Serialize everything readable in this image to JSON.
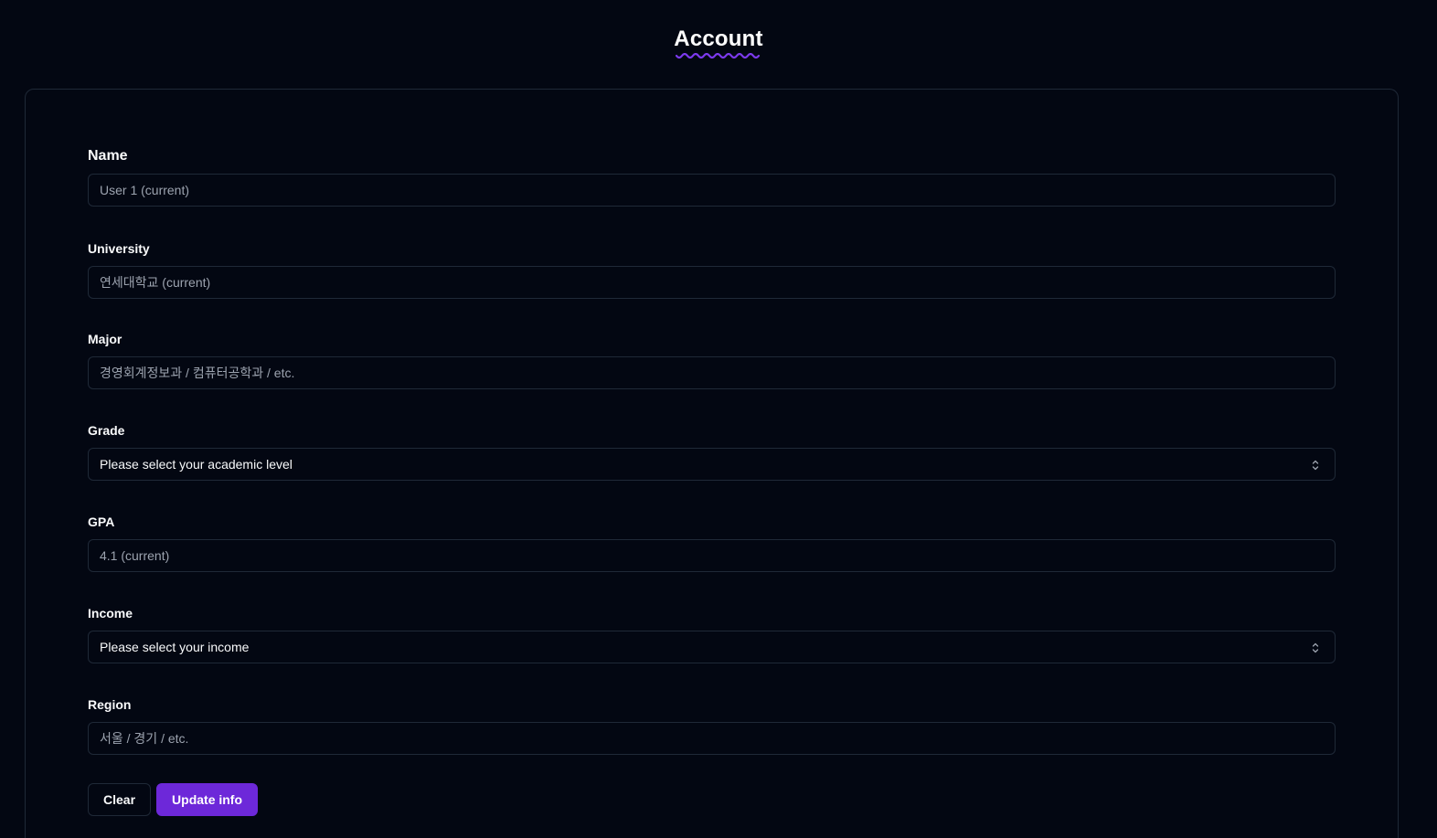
{
  "header": {
    "title": "Account"
  },
  "form": {
    "name": {
      "label": "Name",
      "placeholder": "User 1 (current)"
    },
    "university": {
      "label": "University",
      "placeholder": "연세대학교 (current)"
    },
    "major": {
      "label": "Major",
      "placeholder": "경영회계정보과 / 컴퓨터공학과 / etc."
    },
    "grade": {
      "label": "Grade",
      "selected": "Please select your academic level"
    },
    "gpa": {
      "label": "GPA",
      "placeholder": "4.1 (current)"
    },
    "income": {
      "label": "Income",
      "selected": "Please select your income"
    },
    "region": {
      "label": "Region",
      "placeholder": "서울 / 경기 / etc."
    }
  },
  "actions": {
    "clear_label": "Clear",
    "update_label": "Update info"
  },
  "theme": {
    "background": "#030712",
    "border": "#1f2937",
    "accent": "#6d28d9",
    "underline": "#7c3aed"
  }
}
